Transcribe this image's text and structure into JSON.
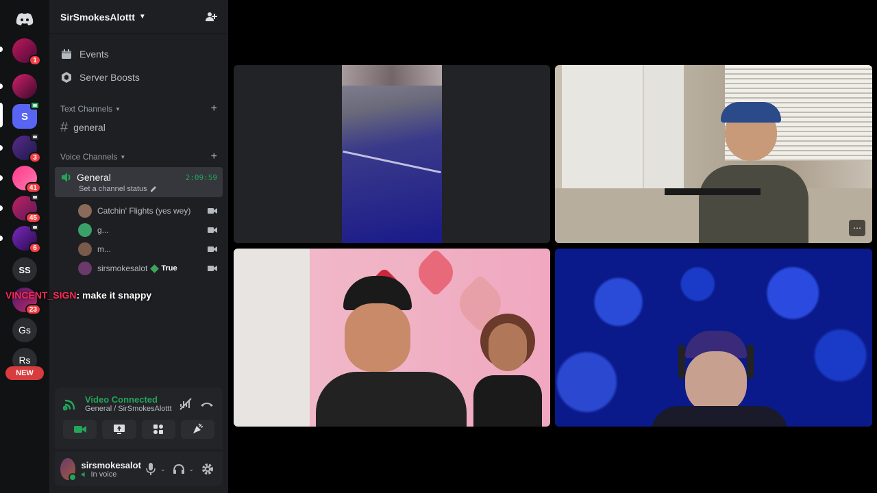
{
  "rail": {
    "guilds": [
      {
        "label": "",
        "badge": "1"
      },
      {
        "label": "",
        "badge": ""
      },
      {
        "label": "S",
        "badge": ""
      },
      {
        "label": "",
        "badge": "3"
      },
      {
        "label": "",
        "badge": "41"
      },
      {
        "label": "",
        "badge": "45"
      },
      {
        "label": "",
        "badge": "6"
      },
      {
        "label": "SS",
        "badge": ""
      },
      {
        "label": "",
        "badge": "23"
      },
      {
        "label": "Gs",
        "badge": ""
      },
      {
        "label": "Rs",
        "badge": ""
      }
    ],
    "new_label": "NEW"
  },
  "sidebar": {
    "server_name": "SirSmokesAlottt",
    "events_label": "Events",
    "boosts_label": "Server Boosts",
    "text_category": "Text Channels",
    "text_channel": "general",
    "voice_category": "Voice Channels",
    "voice_channel": {
      "name": "General",
      "elapsed": "2:09:59",
      "status_placeholder": "Set a channel status"
    },
    "members": [
      {
        "name": "Catchin' Flights (yes wey)",
        "color": "#8a6a5a"
      },
      {
        "name": "g...",
        "color": "#3aa06a"
      },
      {
        "name": "m...",
        "color": "#7a5a4a"
      },
      {
        "name": "sirsmokesalot",
        "color": "#6a3a6a",
        "tag": "True"
      }
    ]
  },
  "chat_overlay": {
    "user": "VINCENT_SIGN",
    "message": ": make it snappy"
  },
  "rtc": {
    "status": "Video Connected",
    "location": "General / SirSmokesAlottt"
  },
  "user_panel": {
    "username": "sirsmokesalot",
    "status": "In voice"
  },
  "colors": {
    "accent_green": "#23a55a",
    "mention_red": "#f23f43",
    "blurple": "#5865f2"
  }
}
